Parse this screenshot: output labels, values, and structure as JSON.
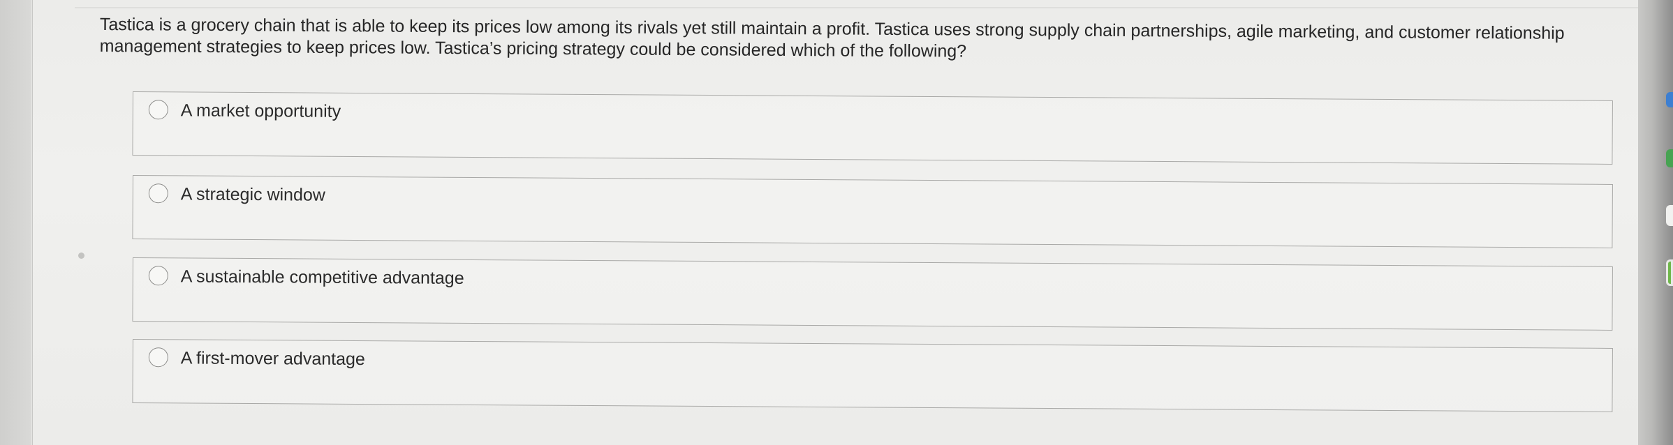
{
  "question": {
    "text": "Tastica is a grocery chain that is able to keep its prices low among its rivals yet still maintain a profit. Tastica uses strong supply chain partnerships, agile marketing, and customer relationship management strategies to keep prices low. Tastica’s pricing strategy could be considered which of the following?"
  },
  "options": [
    {
      "label": "A market opportunity",
      "selected": false
    },
    {
      "label": "A strategic window",
      "selected": false
    },
    {
      "label": "A sustainable competitive advantage",
      "selected": false
    },
    {
      "label": "A first-mover advantage",
      "selected": false
    }
  ],
  "colors": {
    "background": "#ececea",
    "text": "#262626",
    "border": "#a9a9a7",
    "edge_blue": "#3d7fd1",
    "edge_green": "#47a352"
  }
}
